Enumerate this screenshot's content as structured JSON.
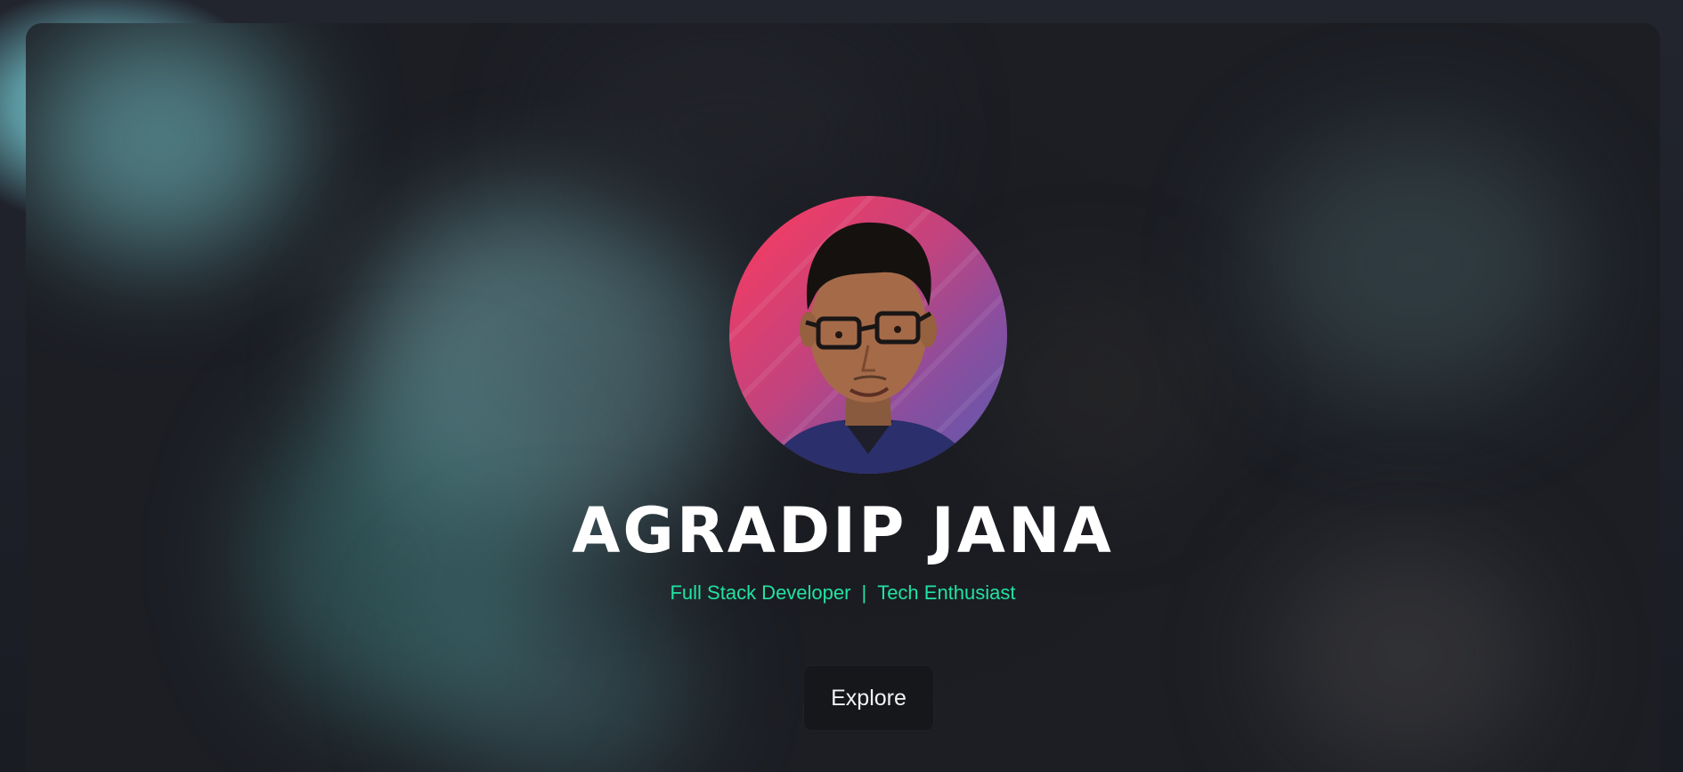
{
  "hero": {
    "name": "AGRADIP JANA",
    "tagline": {
      "role": "Full Stack Developer",
      "separator": "|",
      "interest": "Tech Enthusiast"
    },
    "explore_label": "Explore",
    "avatar_icon": "profile-photo"
  },
  "colors": {
    "background": "#1c1e24",
    "name_text": "#ffffff",
    "tagline_text": "#21e3a0",
    "button_bg": "#15171b",
    "avatar_gradient_start": "#ff3a5c",
    "avatar_gradient_end": "#5a5ab0"
  }
}
